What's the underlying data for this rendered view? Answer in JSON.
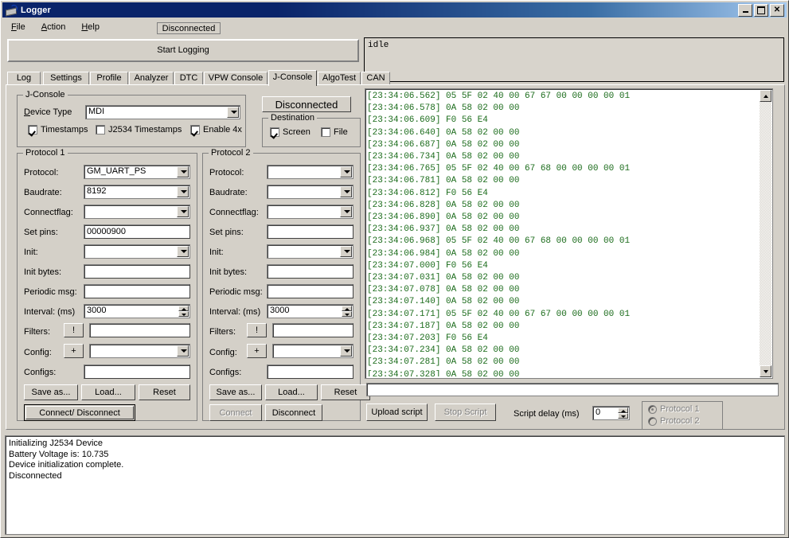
{
  "window": {
    "title": "Logger",
    "icon": "signal-device-icon",
    "buttons": {
      "minimize": "–",
      "maximize": "□",
      "close": "✕"
    }
  },
  "menubar": {
    "items": [
      {
        "label": "File",
        "accel": "F"
      },
      {
        "label": "Action",
        "accel": "A"
      },
      {
        "label": "Help",
        "accel": "H"
      }
    ],
    "status_chip": "Disconnected"
  },
  "toolbar": {
    "start_logging": "Start Logging",
    "idle_text": "idle"
  },
  "tabs": [
    {
      "label": "Log",
      "active": false
    },
    {
      "label": "Settings",
      "active": false
    },
    {
      "label": "Profile",
      "active": false
    },
    {
      "label": "Analyzer",
      "active": false
    },
    {
      "label": "DTC",
      "active": false
    },
    {
      "label": "VPW Console",
      "active": false
    },
    {
      "label": "J-Console",
      "active": true
    },
    {
      "label": "AlgoTest",
      "active": false
    },
    {
      "label": "CAN",
      "active": false
    }
  ],
  "jconsole": {
    "group_label": "J-Console",
    "device_type_label": "Device Type",
    "device_type_accel": "D",
    "device_type_value": "MDI",
    "timestamps_label": "Timestamps",
    "timestamps_checked": true,
    "j2534_timestamps_label": "J2534 Timestamps",
    "j2534_timestamps_checked": false,
    "enable4x_label": "Enable 4x",
    "enable4x_checked": true
  },
  "connection": {
    "status_button": "Disconnected",
    "destination_label": "Destination",
    "screen_label": "Screen",
    "screen_checked": true,
    "file_label": "File",
    "file_checked": false
  },
  "protocol1": {
    "group_label": "Protocol 1",
    "fields": {
      "protocol_label": "Protocol:",
      "protocol_value": "GM_UART_PS",
      "baudrate_label": "Baudrate:",
      "baudrate_value": "8192",
      "connectflag_label": "Connectflag:",
      "connectflag_value": "",
      "setpins_label": "Set pins:",
      "setpins_value": "00000900",
      "init_label": "Init:",
      "init_value": "",
      "initbytes_label": "Init bytes:",
      "initbytes_value": "",
      "periodicmsg_label": "Periodic msg:",
      "periodicmsg_value": "",
      "interval_label": "Interval: (ms)",
      "interval_value": "3000",
      "filters_label": "Filters:",
      "filters_button": "!",
      "filters_value": "",
      "config_label": "Config:",
      "config_button": "+",
      "config_value": "",
      "configs_label": "Configs:",
      "configs_value": ""
    },
    "buttons": {
      "save_as": "Save as...",
      "load": "Load...",
      "reset": "Reset",
      "connect_disconnect": "Connect/ Disconnect"
    }
  },
  "protocol2": {
    "group_label": "Protocol 2",
    "fields": {
      "protocol_label": "Protocol:",
      "protocol_value": "",
      "baudrate_label": "Baudrate:",
      "baudrate_value": "",
      "connectflag_label": "Connectflag:",
      "connectflag_value": "",
      "setpins_label": "Set pins:",
      "setpins_value": "",
      "init_label": "Init:",
      "init_value": "",
      "initbytes_label": "Init bytes:",
      "initbytes_value": "",
      "periodicmsg_label": "Periodic msg:",
      "periodicmsg_value": "",
      "interval_label": "Interval: (ms)",
      "interval_value": "3000",
      "filters_label": "Filters:",
      "filters_button": "!",
      "filters_value": "",
      "config_label": "Config:",
      "config_button": "+",
      "config_value": "",
      "configs_label": "Configs:",
      "configs_value": ""
    },
    "buttons": {
      "save_as": "Save as...",
      "load": "Load...",
      "reset": "Reset",
      "connect": "Connect",
      "connect_disabled": true,
      "disconnect": "Disconnect"
    }
  },
  "console": {
    "text": "[23:34:06.562] 05 5F 02 40 00 67 67 00 00 00 00 01\n[23:34:06.578] 0A 58 02 00 00\n[23:34:06.609] F0 56 E4\n[23:34:06.640] 0A 58 02 00 00\n[23:34:06.687] 0A 58 02 00 00\n[23:34:06.734] 0A 58 02 00 00\n[23:34:06.765] 05 5F 02 40 00 67 68 00 00 00 00 01\n[23:34:06.781] 0A 58 02 00 00\n[23:34:06.812] F0 56 E4\n[23:34:06.828] 0A 58 02 00 00\n[23:34:06.890] 0A 58 02 00 00\n[23:34:06.937] 0A 58 02 00 00\n[23:34:06.968] 05 5F 02 40 00 67 68 00 00 00 00 01\n[23:34:06.984] 0A 58 02 00 00\n[23:34:07.000] F0 56 E4\n[23:34:07.031] 0A 58 02 00 00\n[23:34:07.078] 0A 58 02 00 00\n[23:34:07.140] 0A 58 02 00 00\n[23:34:07.171] 05 5F 02 40 00 67 67 00 00 00 00 01\n[23:34:07.187] 0A 58 02 00 00\n[23:34:07.203] F0 56 E4\n[23:34:07.234] 0A 58 02 00 00\n[23:34:07.281] 0A 58 02 00 00\n[23:34:07.328] 0A 58 02 00 00",
    "text_color": "#1a6b1a",
    "command_value": ""
  },
  "script_bar": {
    "upload_script": "Upload script",
    "stop_script": "Stop Script",
    "stop_script_disabled": true,
    "script_delay_label": "Script delay (ms)",
    "script_delay_value": "0",
    "protocol1_radio": "Protocol 1",
    "protocol2_radio": "Protocol 2",
    "radio_selected": "Protocol 1",
    "radio_group_disabled": true
  },
  "bottom_log": {
    "lines": [
      "Initializing J2534 Device",
      "Battery Voltage is: 10.735",
      "Device initialization complete.",
      "Disconnected"
    ]
  }
}
